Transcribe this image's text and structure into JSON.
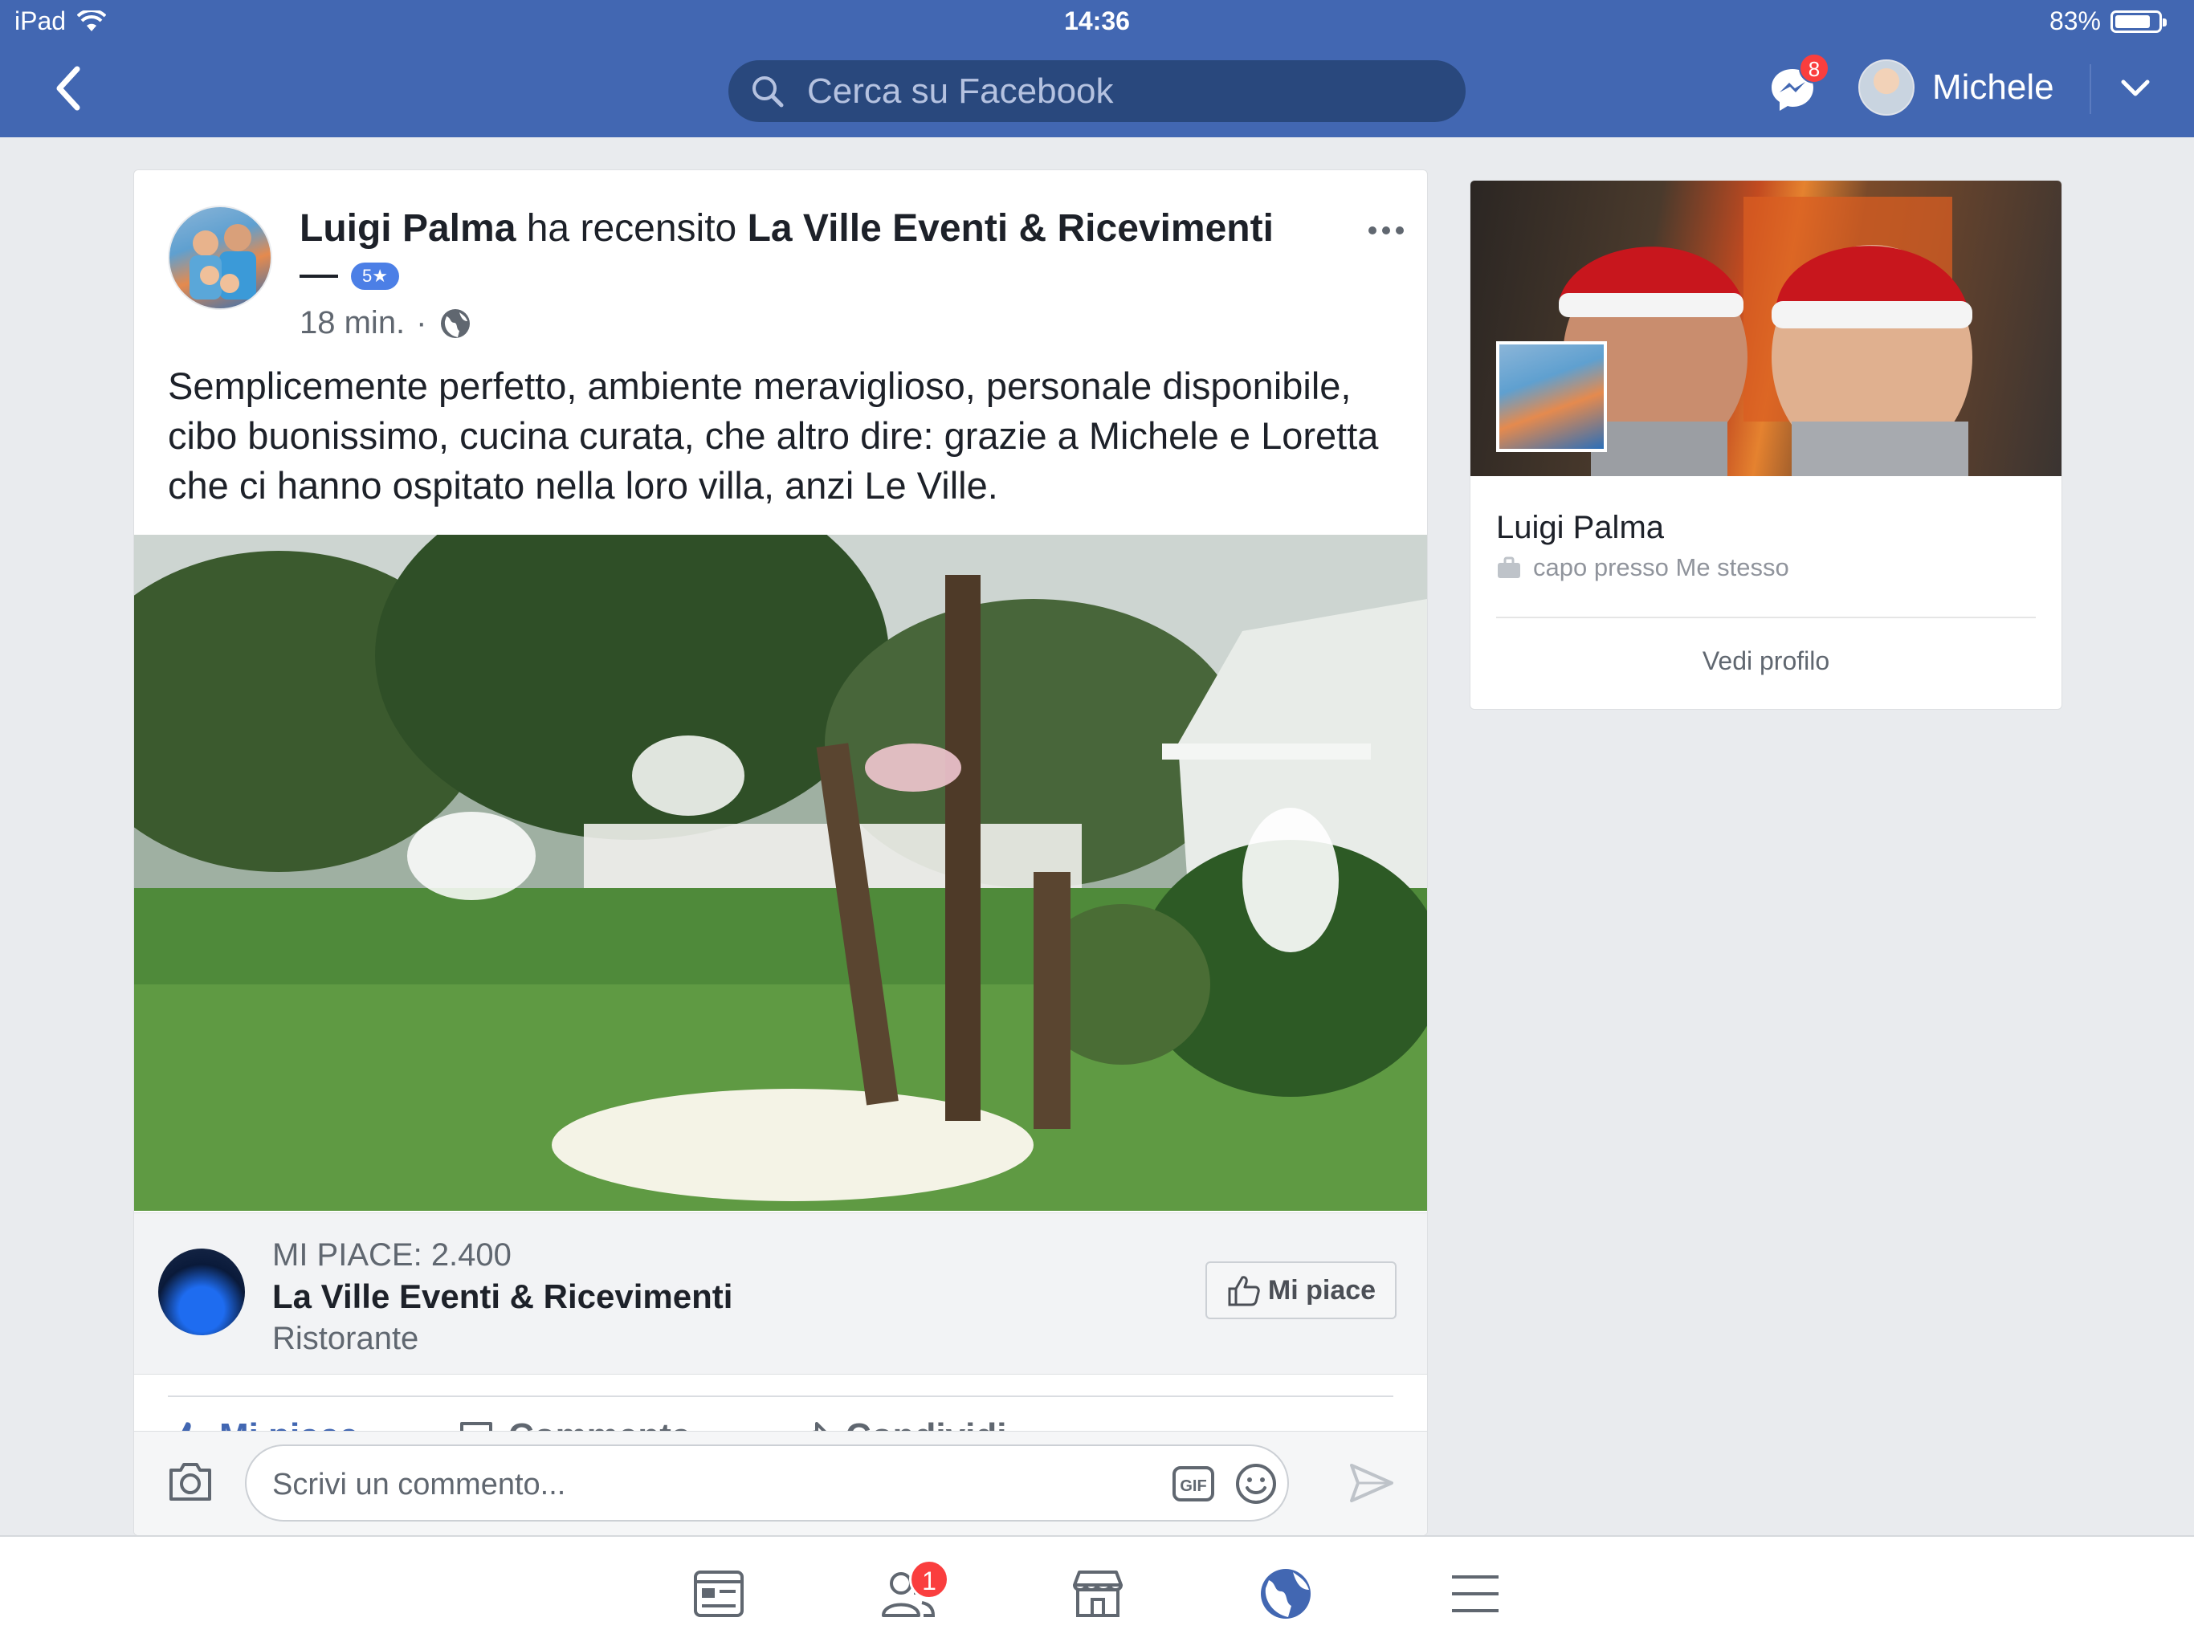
{
  "status_bar": {
    "device": "iPad",
    "time": "14:36",
    "battery": "83%",
    "battery_level": 0.83
  },
  "header": {
    "search_placeholder": "Cerca su Facebook",
    "messenger_badge": "8",
    "user_name": "Michele"
  },
  "post": {
    "author": "Luigi Palma",
    "action": "ha recensito",
    "target_page": "La Ville Eventi & Ricevimenti",
    "rating_badge": "5★",
    "time": "18 min.",
    "separator": "·",
    "text": "Semplicemente perfetto, ambiente meraviglioso, personale disponibile, cibo buonissimo, cucina curata, che altro dire: grazie a Michele e Loretta che ci hanno ospitato nella loro villa, anzi Le Ville.",
    "page_card": {
      "likes": "MI PIACE: 2.400",
      "name": "La Ville Eventi & Ricevimenti",
      "category": "Ristorante",
      "like_button": "Mi piace"
    },
    "actions": {
      "like": "Mi piace",
      "comment": "Commenta",
      "share": "Condividi"
    },
    "comment_placeholder": "Scrivi un commento..."
  },
  "profile_card": {
    "name": "Luigi Palma",
    "work": "capo presso Me stesso",
    "view_profile": "Vedi profilo"
  },
  "tabbar": {
    "friends_badge": "1",
    "items": [
      "news-feed-icon",
      "friends-icon",
      "marketplace-icon",
      "notifications-globe-icon",
      "menu-icon"
    ],
    "active_color": "#4267b2"
  },
  "colors": {
    "header": "#4267b2",
    "search_bg": "#29487d",
    "badge": "#fa3e3e",
    "background": "#e9ebee"
  }
}
